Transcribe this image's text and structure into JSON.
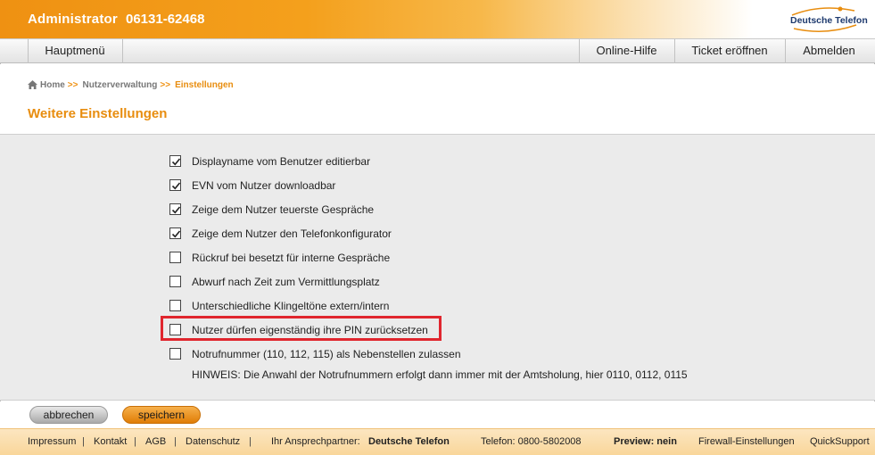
{
  "header": {
    "title": "Administrator",
    "phone": "06131-62468",
    "logo_text": "Deutsche Telefon"
  },
  "nav": {
    "main_menu": "Hauptmenü",
    "online_help": "Online-Hilfe",
    "open_ticket": "Ticket eröffnen",
    "logout": "Abmelden"
  },
  "breadcrumb": {
    "home": "Home",
    "sep": ">>",
    "user_admin": "Nutzerverwaltung",
    "current": "Einstellungen"
  },
  "page_title": "Weitere Einstellungen",
  "options": [
    {
      "label": "Displayname vom Benutzer editierbar",
      "checked": true
    },
    {
      "label": "EVN vom Nutzer downloadbar",
      "checked": true
    },
    {
      "label": "Zeige dem Nutzer teuerste Gespräche",
      "checked": true
    },
    {
      "label": "Zeige dem Nutzer den Telefonkonfigurator",
      "checked": true
    },
    {
      "label": "Rückruf bei besetzt für interne Gespräche",
      "checked": false
    },
    {
      "label": "Abwurf nach Zeit zum Vermittlungsplatz",
      "checked": false
    },
    {
      "label": "Unterschiedliche Klingeltöne extern/intern",
      "checked": false
    },
    {
      "label": "Nutzer dürfen eigenständig ihre PIN zurücksetzen",
      "checked": false
    },
    {
      "label": "Notrufnummer (110, 112, 115) als Nebenstellen zulassen",
      "checked": false
    }
  ],
  "hinweis": "HINWEIS: Die Anwahl der Notrufnummern erfolgt dann immer mit der Amtsholung, hier 0110, 0112, 0115",
  "buttons": {
    "cancel": "abbrechen",
    "save": "speichern"
  },
  "footer": {
    "impressum": "Impressum",
    "kontakt": "Kontakt",
    "agb": "AGB",
    "datenschutz": "Datenschutz",
    "separator": "|",
    "contact_label": "Ihr Ansprechpartner:",
    "contact_name": "Deutsche Telefon",
    "phone": "Telefon: 0800-5802008",
    "preview": "Preview: nein",
    "firewall": "Firewall-Einstellungen",
    "quicksupport": "QuickSupport"
  },
  "colors": {
    "accent": "#e88d0f",
    "highlight_border": "#e0262e",
    "settings_bg": "#ebebeb",
    "footer_bg": "#f9d69a"
  }
}
